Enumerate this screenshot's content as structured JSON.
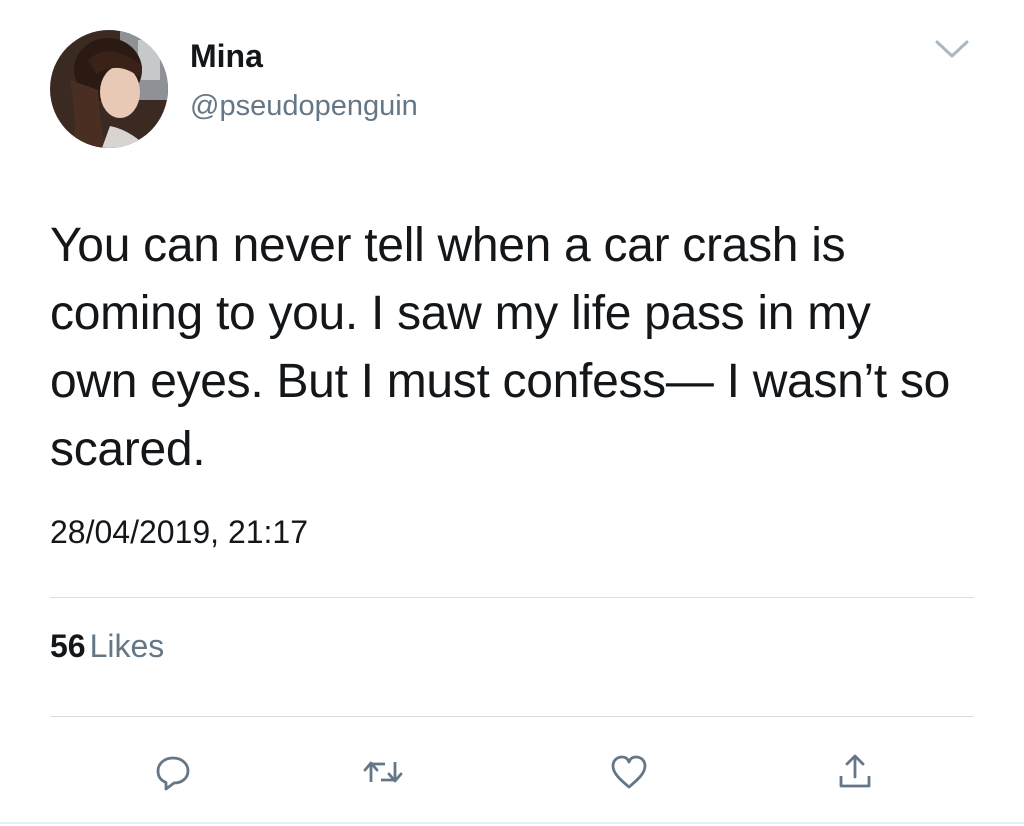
{
  "user": {
    "display_name": "Mina",
    "handle": "@pseudopenguin",
    "avatar_icon": "profile-photo"
  },
  "tweet": {
    "text": "You can never tell when a car crash is coming to you. I saw my life pass in my own eyes. But I must confess— I wasn’t so scared.",
    "timestamp": "28/04/2019, 21:17"
  },
  "stats": {
    "likes_count": "56",
    "likes_label": "Likes"
  },
  "actions": [
    {
      "icon": "reply-icon"
    },
    {
      "icon": "retweet-icon"
    },
    {
      "icon": "heart-icon"
    },
    {
      "icon": "share-icon"
    }
  ],
  "colors": {
    "text_primary": "#14171a",
    "text_secondary": "#657786",
    "icon": "#657786",
    "divider": "#d9dde1"
  }
}
